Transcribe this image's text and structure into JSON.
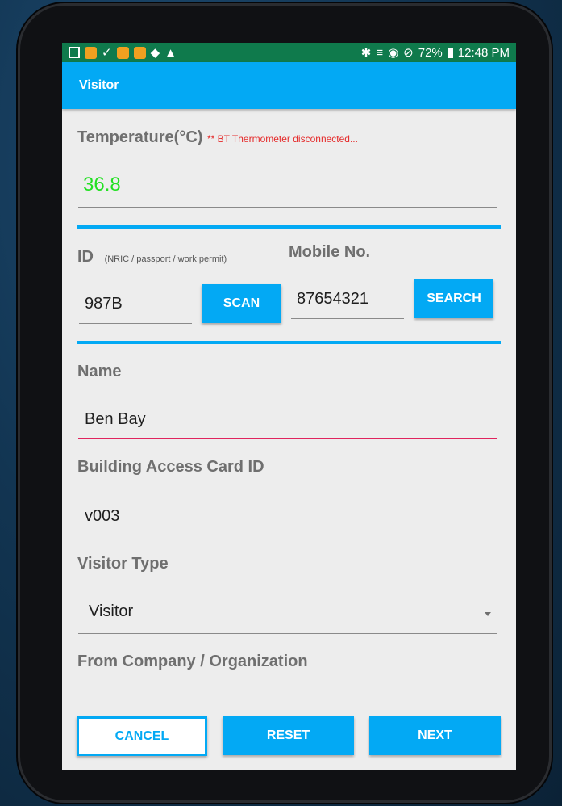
{
  "status_bar": {
    "battery": "72%",
    "time": "12:48 PM"
  },
  "app_bar": {
    "title": "Visitor"
  },
  "temperature": {
    "label": "Temperature(°C)",
    "warning": "** BT Thermometer disconnected...",
    "value": "36.8",
    "value_color": "#22e022"
  },
  "id_field": {
    "label": "ID",
    "hint": "(NRIC / passport / work permit)",
    "value": "987B",
    "scan_label": "SCAN"
  },
  "mobile": {
    "label": "Mobile No.",
    "value": "87654321",
    "search_label": "SEARCH"
  },
  "name": {
    "label": "Name",
    "value": "Ben Bay"
  },
  "access_card": {
    "label": "Building Access Card ID",
    "value": "v003"
  },
  "visitor_type": {
    "label": "Visitor Type",
    "selected": "Visitor"
  },
  "company": {
    "label": "From Company / Organization"
  },
  "actions": {
    "cancel": "CANCEL",
    "reset": "RESET",
    "next": "NEXT"
  },
  "colors": {
    "accent": "#03a9f4",
    "status_bar": "#0f7a4c",
    "error_underline": "#e0245e"
  }
}
